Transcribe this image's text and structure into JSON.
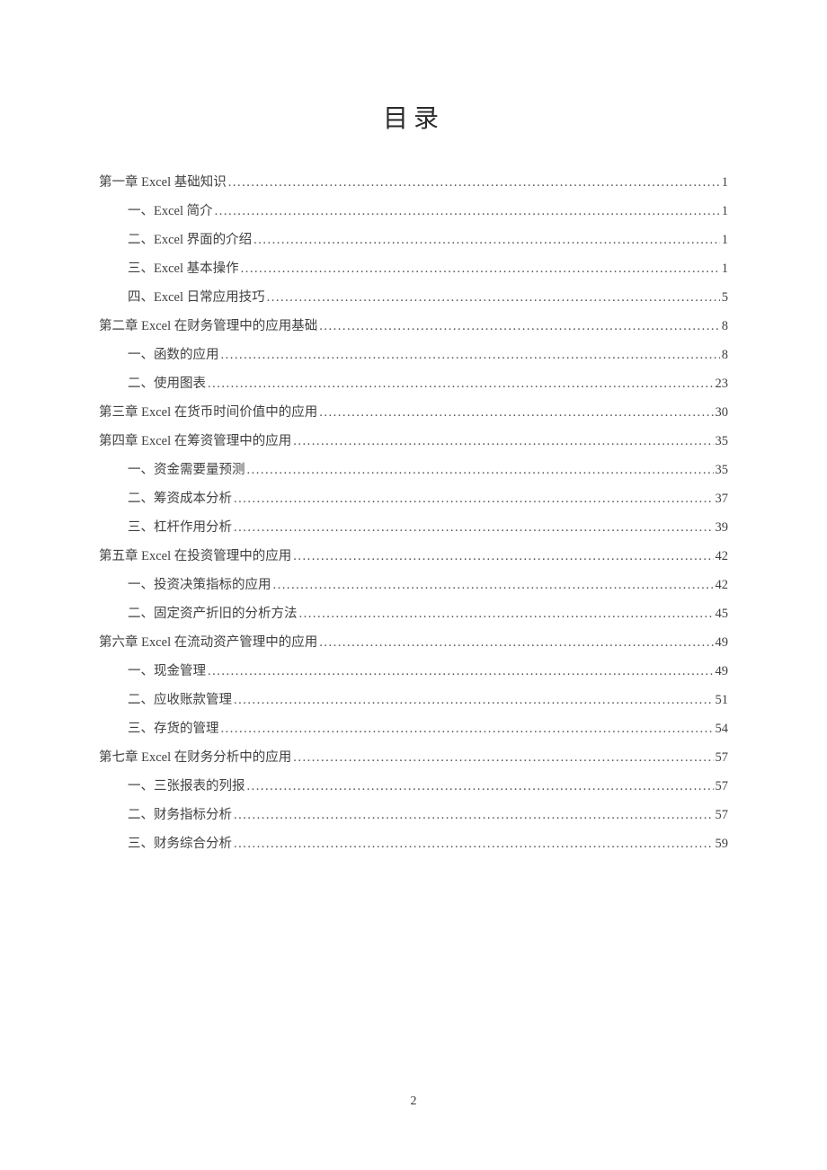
{
  "title": "目录",
  "page_number": "2",
  "toc": [
    {
      "level": 1,
      "label": "第一章  Excel 基础知识",
      "page": "1"
    },
    {
      "level": 2,
      "label": "一、Excel 简介",
      "page": "1"
    },
    {
      "level": 2,
      "label": "二、Excel 界面的介绍",
      "page": "1"
    },
    {
      "level": 2,
      "label": "三、Excel 基本操作",
      "page": "1"
    },
    {
      "level": 2,
      "label": "四、Excel  日常应用技巧",
      "page": "5"
    },
    {
      "level": 1,
      "label": "第二章 Excel 在财务管理中的应用基础",
      "page": "8"
    },
    {
      "level": 2,
      "label": "一、函数的应用",
      "page": "8"
    },
    {
      "level": 2,
      "label": "二、使用图表",
      "page": "23"
    },
    {
      "level": 1,
      "label": "第三章  Excel 在货币时间价值中的应用",
      "page": "30"
    },
    {
      "level": 1,
      "label": "第四章  Excel 在筹资管理中的应用",
      "page": "35"
    },
    {
      "level": 2,
      "label": "一、资金需要量预测",
      "page": "35"
    },
    {
      "level": 2,
      "label": "二、筹资成本分析",
      "page": "37"
    },
    {
      "level": 2,
      "label": "三、杠杆作用分析",
      "page": "39"
    },
    {
      "level": 1,
      "label": "第五章  Excel 在投资管理中的应用",
      "page": "42"
    },
    {
      "level": 2,
      "label": "一、投资决策指标的应用",
      "page": "42"
    },
    {
      "level": 2,
      "label": "二、固定资产折旧的分析方法",
      "page": "45"
    },
    {
      "level": 1,
      "label": "第六章  Excel 在流动资产管理中的应用",
      "page": "49"
    },
    {
      "level": 2,
      "label": "一、现金管理",
      "page": "49"
    },
    {
      "level": 2,
      "label": "二、应收账款管理",
      "page": "51"
    },
    {
      "level": 2,
      "label": "三、存货的管理",
      "page": "54"
    },
    {
      "level": 1,
      "label": "第七章  Excel 在财务分析中的应用",
      "page": "57"
    },
    {
      "level": 2,
      "label": "一、三张报表的列报",
      "page": "57"
    },
    {
      "level": 2,
      "label": "二、财务指标分析",
      "page": "57"
    },
    {
      "level": 2,
      "label": "三、财务综合分析",
      "page": "59"
    }
  ]
}
